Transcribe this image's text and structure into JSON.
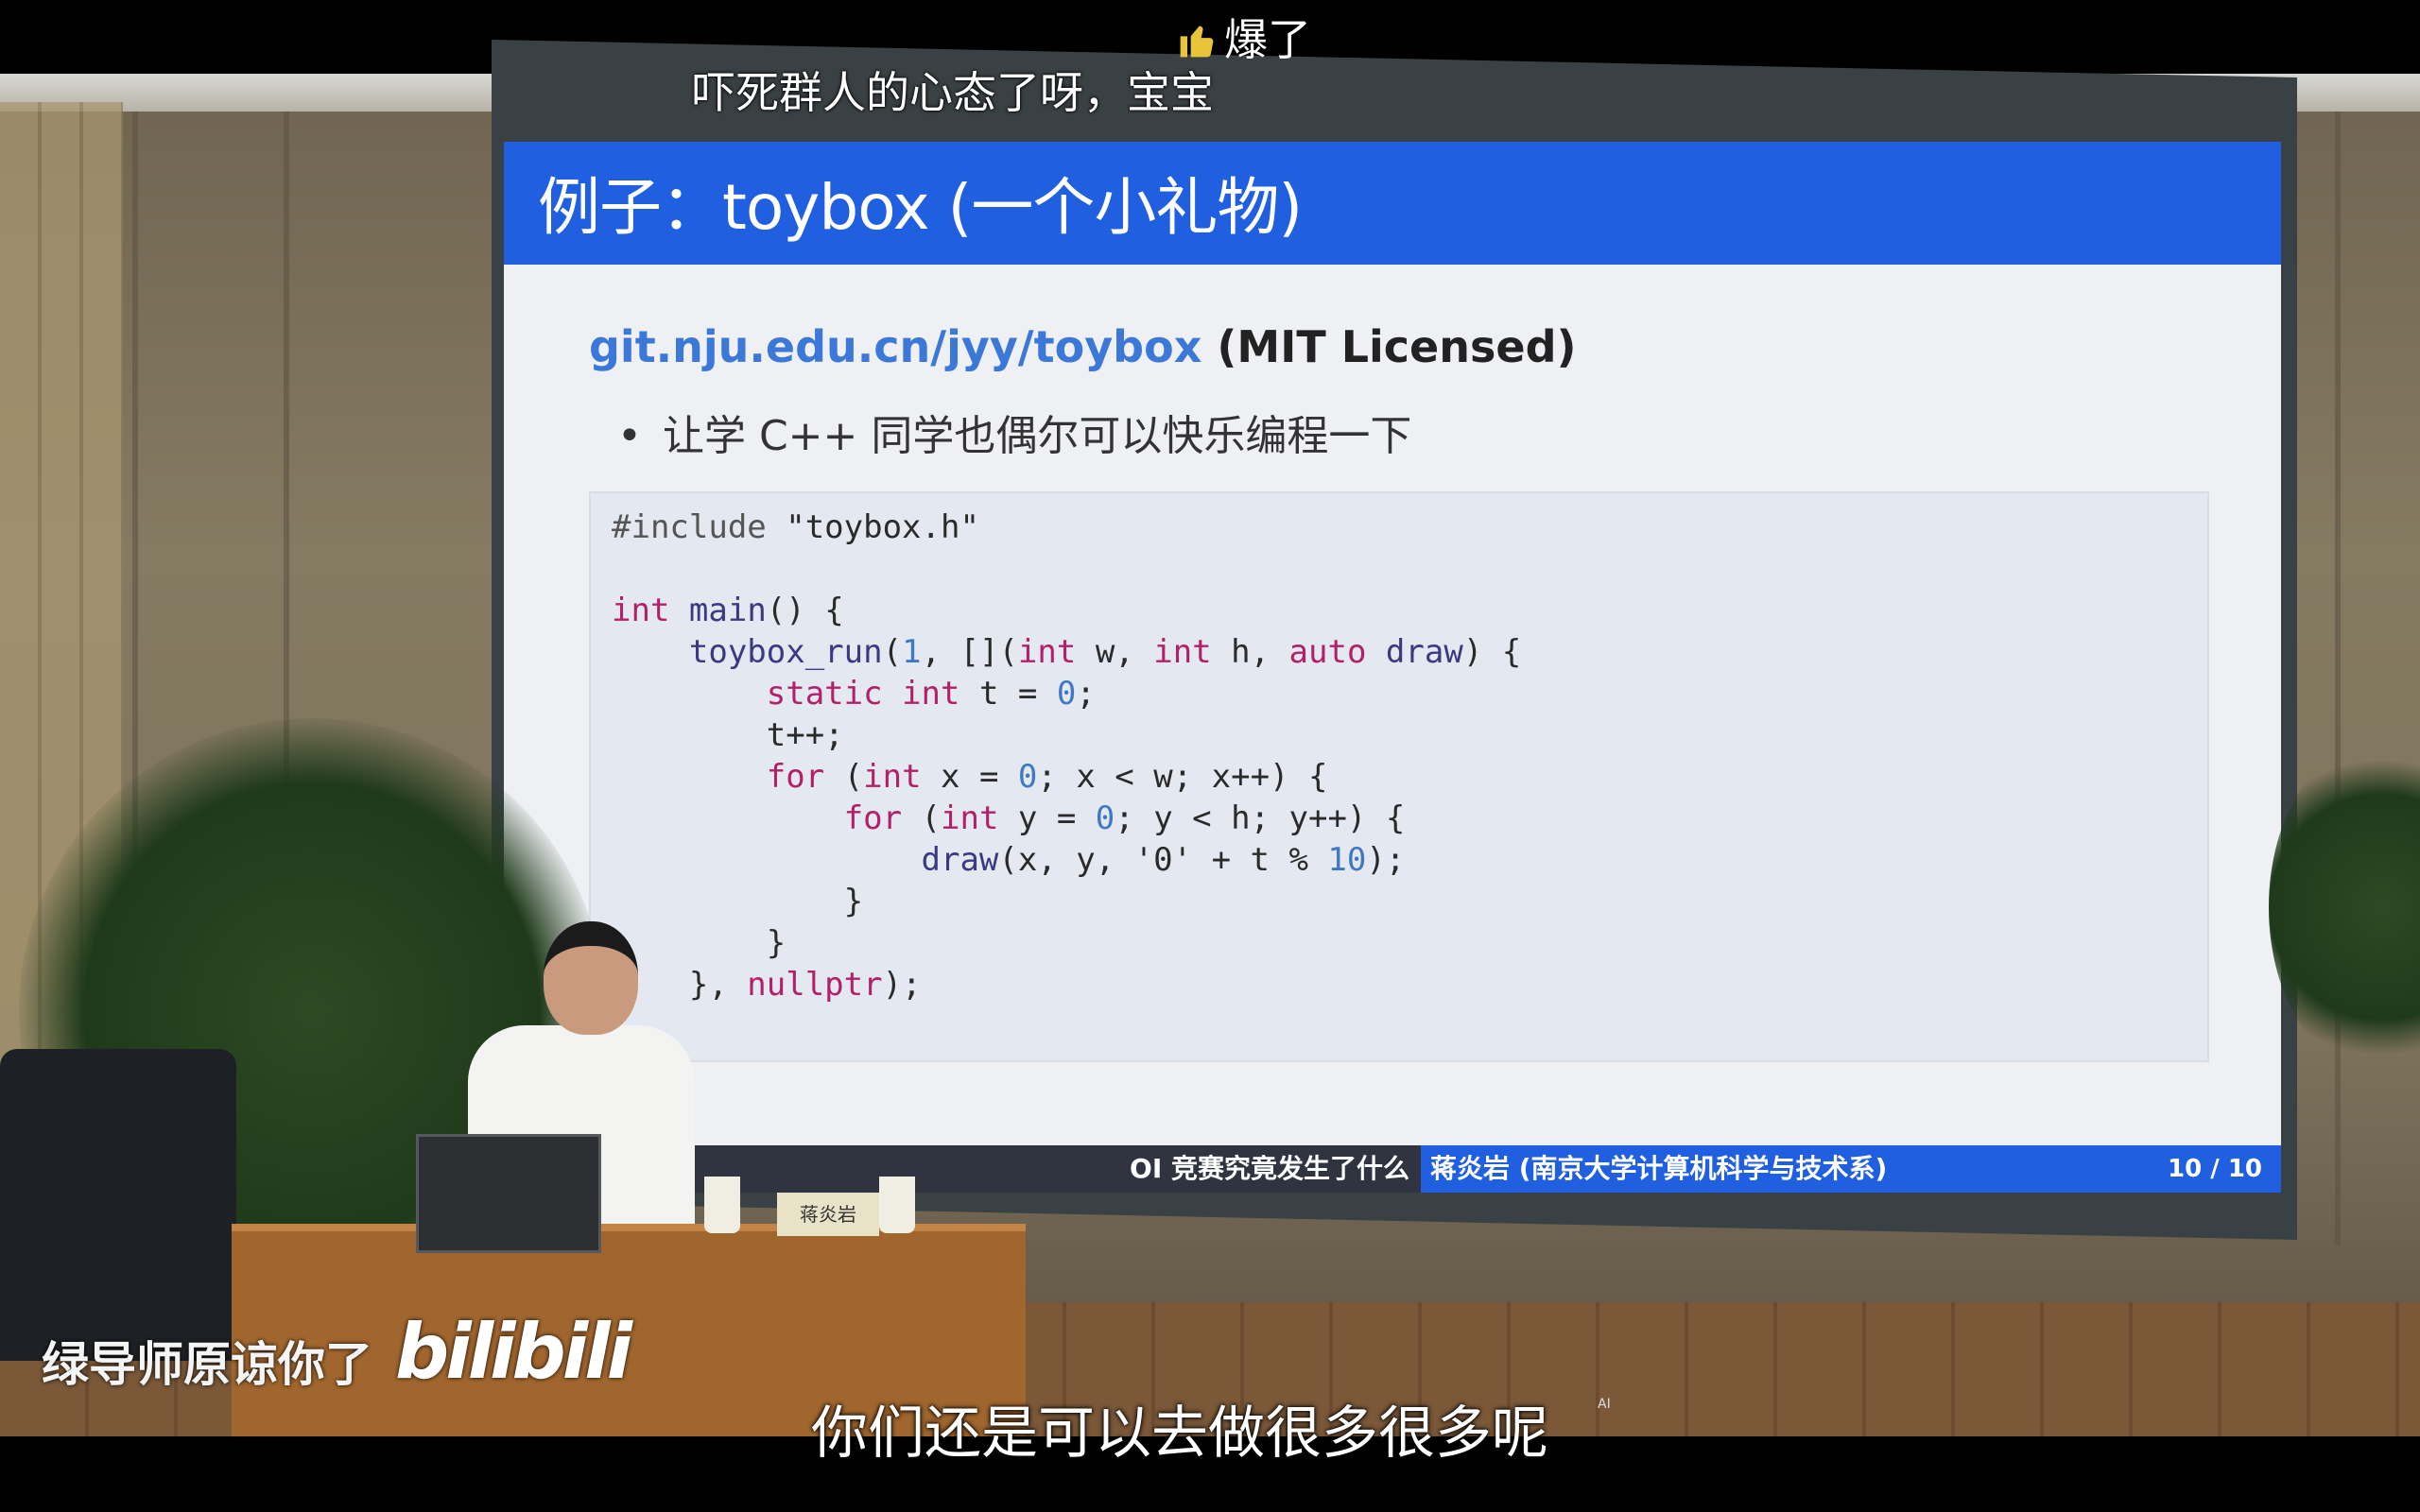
{
  "danmaku": {
    "top_comment": "爆了",
    "second_comment": "吓死群人的心态了呀，宝宝"
  },
  "slide": {
    "title": "例子：toybox (一个小礼物)",
    "link": "git.nju.edu.cn/jyy/toybox",
    "license": "(MIT Licensed)",
    "bullet": "让学 C++ 同学也偶尔可以快乐编程一下",
    "code_lines": [
      "#include \"toybox.h\"",
      "",
      "int main() {",
      "    toybox_run(1, [](int w, int h, auto draw) {",
      "        static int t = 0;",
      "        t++;",
      "        for (int x = 0; x < w; x++) {",
      "            for (int y = 0; y < h; y++) {",
      "                draw(x, y, '0' + t % 10);",
      "            }",
      "        }",
      "    }, nullptr);"
    ],
    "footer_left": "OI 竞赛究竟发生了什么",
    "footer_mid": "蒋炎岩 (南京大学计算机科学与技术系)",
    "footer_page": "10 / 10"
  },
  "nameplate": "蒋炎岩",
  "subtitle": "你们还是可以去做很多很多呢",
  "ai_mark": "AI",
  "watermark": {
    "text": "绿导师原谅你了",
    "logo": "bilibili"
  }
}
